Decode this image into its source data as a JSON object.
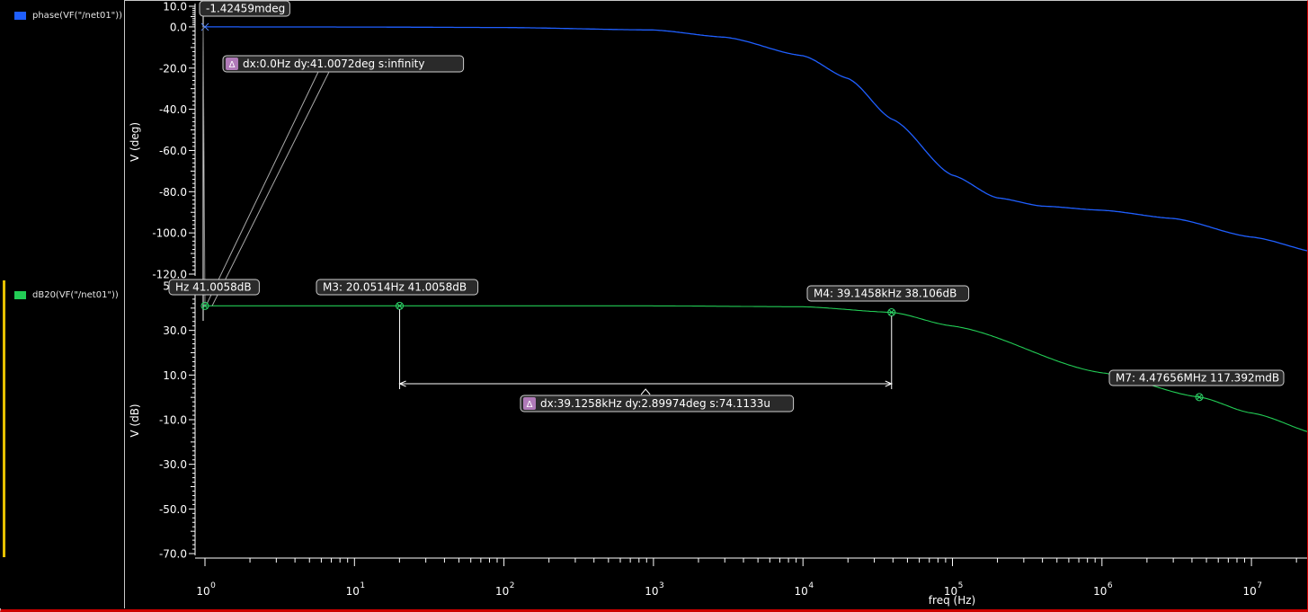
{
  "legend": {
    "phase": {
      "label": "phase(VF(\"/net01\"))",
      "color": "#1f5fff"
    },
    "db": {
      "label": "dB20(VF(\"/net01\"))",
      "color": "#22cc55"
    }
  },
  "colors": {
    "background": "#000000",
    "axis": "#ffffff",
    "marker_box": "#2a2a2a",
    "delta_badge": "#b07ab8"
  },
  "chart_data": [
    {
      "type": "line",
      "series": [
        {
          "name": "phase(VF(\"/net01\"))",
          "x": [
            1,
            10,
            100,
            1000,
            3000,
            10000,
            20000,
            40000,
            100000,
            200000,
            400000,
            1000000,
            3000000,
            10000000,
            30000000
          ],
          "y": [
            -0.0014,
            -0.06,
            -0.3,
            -1.5,
            -5,
            -14,
            -25,
            -45,
            -72,
            -83,
            -87,
            -89,
            -93,
            -102,
            -110
          ]
        }
      ],
      "xscale": "log",
      "xlim": [
        1,
        30000000
      ],
      "ylabel": "V (deg)",
      "ylim": [
        -120,
        10
      ],
      "yticks": [
        "10.0",
        "0.0",
        "-20.0",
        "-40.0",
        "-60.0",
        "-80.0",
        "-100.0",
        "-120.0"
      ],
      "annotations": [
        {
          "type": "marker",
          "label": "-1.42459mdeg",
          "x": 1,
          "y": -0.0014
        },
        {
          "type": "delta",
          "label": "dx:0.0Hz dy:41.0072deg s:infinity"
        }
      ]
    },
    {
      "type": "line",
      "series": [
        {
          "name": "dB20(VF(\"/net01\"))",
          "x": [
            1,
            20.0514,
            1000,
            10000,
            39145.8,
            100000,
            1000000,
            4476560,
            10000000,
            30000000
          ],
          "y": [
            41.0058,
            41.0058,
            41.0,
            40.6,
            38.106,
            32,
            11,
            0.117392,
            -7,
            -17
          ]
        }
      ],
      "xscale": "log",
      "xlim": [
        1,
        30000000
      ],
      "xlabel": "freq (Hz)",
      "ylabel": "V (dB)",
      "ylim": [
        -70,
        50
      ],
      "yticks": [
        "50.0",
        "30.0",
        "10.0",
        "-10.0",
        "-30.0",
        "-50.0",
        "-70.0"
      ],
      "xticks": [
        {
          "base": "10",
          "exp": "0"
        },
        {
          "base": "10",
          "exp": "1"
        },
        {
          "base": "10",
          "exp": "2"
        },
        {
          "base": "10",
          "exp": "3"
        },
        {
          "base": "10",
          "exp": "4"
        },
        {
          "base": "10",
          "exp": "5"
        },
        {
          "base": "10",
          "exp": "6"
        },
        {
          "base": "10",
          "exp": "7"
        }
      ],
      "annotations": [
        {
          "type": "marker",
          "label": "Hz 41.0058dB",
          "x": 1,
          "y": 41.0058
        },
        {
          "type": "marker",
          "label": "M3: 20.0514Hz 41.0058dB",
          "x": 20.0514,
          "y": 41.0058
        },
        {
          "type": "marker",
          "label": "M4: 39.1458kHz 38.106dB",
          "x": 39145.8,
          "y": 38.106
        },
        {
          "type": "marker",
          "label": "M7: 4.47656MHz 117.392mdB",
          "x": 4476560,
          "y": 0.117392
        },
        {
          "type": "delta",
          "label": "dx:39.1258kHz dy:2.89974deg s:74.1133u"
        }
      ]
    }
  ]
}
